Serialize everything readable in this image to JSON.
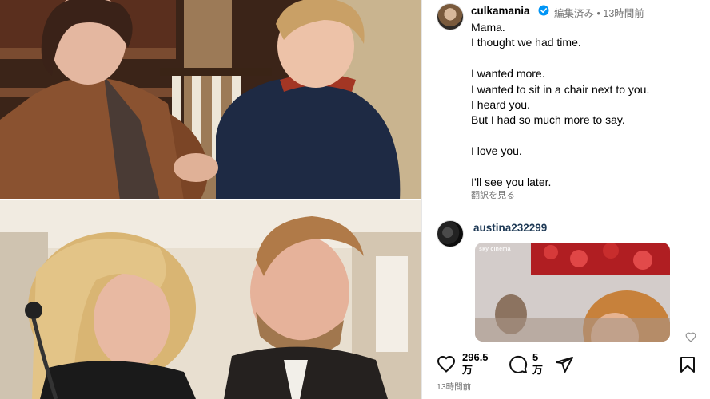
{
  "post": {
    "author": "culkamania",
    "edited": "編集済み",
    "time_separator": "•",
    "time_ago": "13時間前",
    "caption_lines": [
      "Mama.",
      "I thought we had time.",
      "",
      "I wanted more.",
      "I wanted to sit in a chair next to you.",
      "I heard you.",
      "But I had so much more to say.",
      "",
      "I love you.",
      "",
      "I’ll see you later."
    ],
    "translate_link": "翻訳を見る"
  },
  "comment": {
    "author": "austina232299",
    "gif_watermark": "sky cinema"
  },
  "actions": {
    "likes_count": "296.5 万",
    "comments_count": "5 万",
    "timestamp": "13時間前"
  },
  "icons": {
    "verified": "verified-badge-icon",
    "like": "heart-icon",
    "comment": "comment-bubble-icon",
    "share": "paper-plane-icon",
    "save": "bookmark-icon",
    "comment_like": "small-heart-icon"
  },
  "colors": {
    "verified_blue": "#0095f6",
    "secondary_text": "#737373",
    "border": "#e6e6e6"
  }
}
